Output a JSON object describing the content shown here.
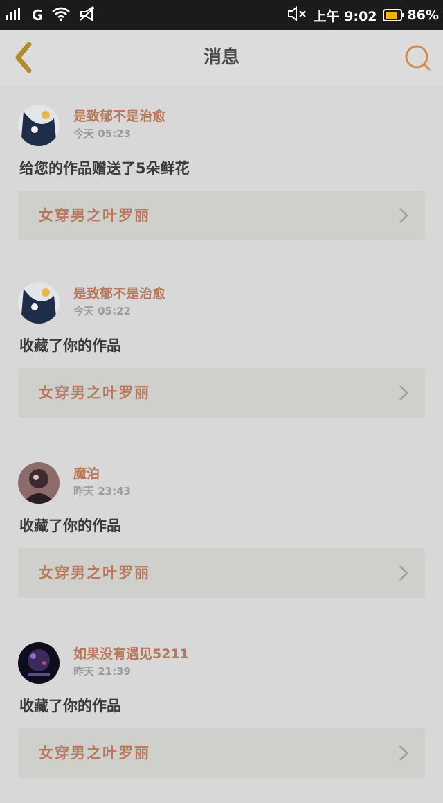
{
  "status_bar": {
    "carrier": "G",
    "time_label": "上午 9:02",
    "battery_percent": "86%",
    "battery_level": 0.86,
    "icons": [
      "signal-icon",
      "wifi-icon",
      "notification-icon",
      "mute-icon"
    ]
  },
  "header": {
    "title": "消息",
    "back_icon": "chevron-left-icon",
    "search_icon": "search-icon",
    "accent_color": "#b58a2a"
  },
  "messages": [
    {
      "username": "是致郁不是治愈",
      "time": "今天 05:23",
      "action": "给您的作品赠送了5朵鲜花",
      "work_title": "女穿男之叶罗丽",
      "avatar_colors": [
        "#dfe4e8",
        "#1f2c4a"
      ]
    },
    {
      "username": "是致郁不是治愈",
      "time": "今天 05:22",
      "action": "收藏了你的作品",
      "work_title": "女穿男之叶罗丽",
      "avatar_colors": [
        "#dfe4e8",
        "#1f2c4a"
      ]
    },
    {
      "username": "魔泊",
      "time": "昨天 23:43",
      "action": "收藏了你的作品",
      "work_title": "女穿男之叶罗丽",
      "avatar_colors": [
        "#8c6b69",
        "#3b2a30"
      ]
    },
    {
      "username": "如果没有遇见5211",
      "time": "昨天 21:39",
      "action": "收藏了你的作品",
      "work_title": "女穿男之叶罗丽",
      "avatar_colors": [
        "#3a2b5a",
        "#0e0d1c"
      ]
    }
  ]
}
